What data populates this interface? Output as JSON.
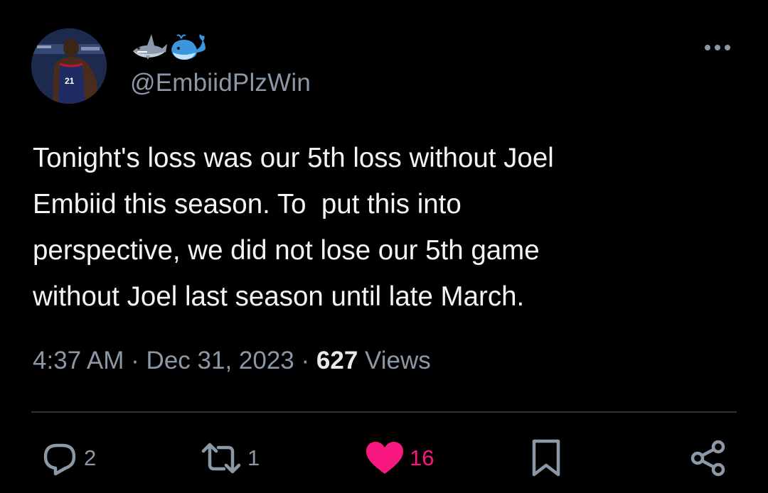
{
  "tweet": {
    "display_name_emojis": [
      "shark-emoji",
      "whale-emoji"
    ],
    "handle": "@EmbiidPlzWin",
    "text_lines": [
      "Tonight's loss was our 5th loss without Joel",
      "Embiid this season. To  put this into",
      "perspective, we did not lose our 5th game",
      "without Joel last season until late March."
    ],
    "time": "4:37 AM",
    "separator": "·",
    "date": "Dec 31, 2023",
    "views_count": "627",
    "views_label": "Views"
  },
  "actions": {
    "reply_count": "2",
    "retweet_count": "1",
    "like_count": "16",
    "liked": true
  },
  "colors": {
    "background": "#000000",
    "text": "#e7e9ea",
    "secondary": "#8b98a5",
    "like_active": "#f91880",
    "divider": "#2f3336"
  },
  "avatar": {
    "jersey_number": "21"
  }
}
